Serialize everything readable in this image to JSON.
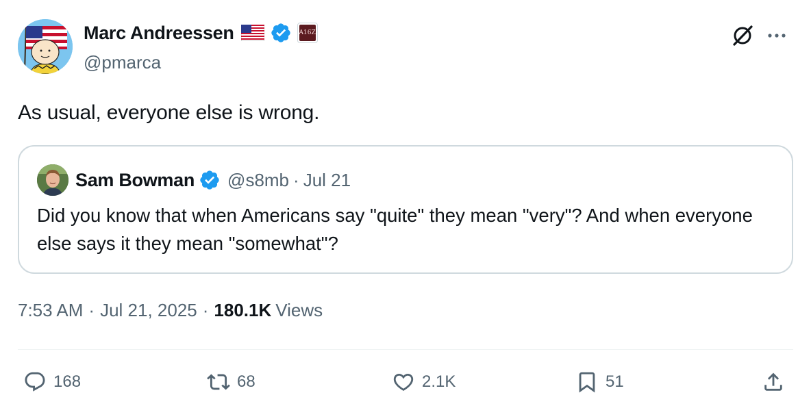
{
  "author": {
    "display_name": "Marc Andreessen",
    "handle": "@pmarca",
    "affiliate_badge_text": "A16Z"
  },
  "tweet": {
    "text": "As usual, everyone else is wrong.",
    "time": "7:53 AM",
    "date": "Jul 21, 2025",
    "separator": "·",
    "views_count": "180.1K",
    "views_label": "Views"
  },
  "quote": {
    "display_name": "Sam Bowman",
    "handle": "@s8mb",
    "separator": "·",
    "date": "Jul 21",
    "text": "Did you know that when Americans say \"quite\" they mean \"very\"? And when everyone else says it they mean \"somewhat\"?"
  },
  "actions": {
    "replies": "168",
    "reposts": "68",
    "likes": "2.1K",
    "bookmarks": "51"
  },
  "icons": {
    "verified": "verified-badge-icon",
    "flag": "us-flag-icon",
    "grok": "grok-icon",
    "more": "more-icon",
    "reply": "reply-icon",
    "repost": "repost-icon",
    "like": "like-icon",
    "bookmark": "bookmark-icon",
    "share": "share-icon"
  },
  "colors": {
    "verified_blue": "#1d9bf0",
    "secondary_text": "#536471",
    "primary_text": "#0f1419",
    "border": "#cfd9de"
  }
}
